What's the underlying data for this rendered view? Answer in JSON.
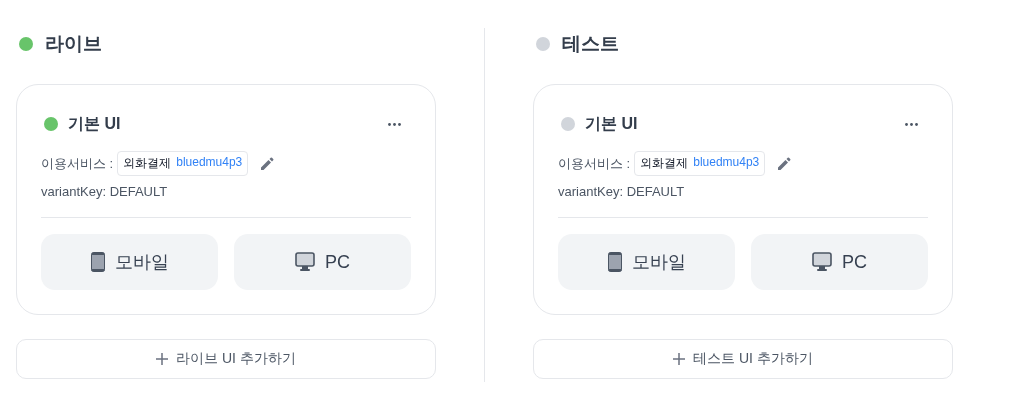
{
  "sections": [
    {
      "title": "라이브",
      "color": "#68c46a",
      "cards": [
        {
          "title": "기본 UI",
          "color": "#68c46a",
          "service_label": "이용서비스 :",
          "service_name": "외화결제",
          "service_id": "bluedmu4p3",
          "variant": "variantKey: DEFAULT",
          "devices": [
            {
              "kind": "mobile",
              "label": "모바일"
            },
            {
              "kind": "pc",
              "label": "PC"
            }
          ]
        }
      ],
      "add_button": "라이브 UI 추가하기"
    },
    {
      "title": "테스트",
      "color": "#d1d5db",
      "cards": [
        {
          "title": "기본 UI",
          "color": "#d1d5db",
          "service_label": "이용서비스 :",
          "service_name": "외화결제",
          "service_id": "bluedmu4p3",
          "variant": "variantKey: DEFAULT",
          "devices": [
            {
              "kind": "mobile",
              "label": "모바일"
            },
            {
              "kind": "pc",
              "label": "PC"
            }
          ]
        }
      ],
      "add_button": "테스트 UI 추가하기"
    }
  ]
}
